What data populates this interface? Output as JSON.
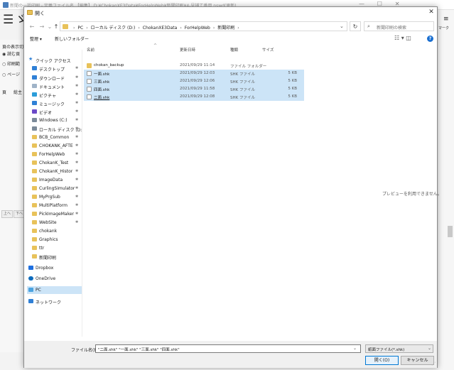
{
  "background_app": {
    "title": "新聞の一括印刷 - 定義ファイル名 【編集】 D:¥ChokanXE3Data¥ForHelpWeb¥新聞印刷¥4-見捕て番用.nswd(更新)",
    "left_labels": [
      "頁の表示切",
      "◉ 読む頁",
      "○ 印刷範",
      "○ ページ",
      "頁",
      "総主"
    ],
    "bottom_buttons": [
      "上へ",
      "下へ"
    ],
    "right_label": "マーク"
  },
  "dialog": {
    "title": "開く",
    "close_glyph": "✕",
    "nav": {
      "back": "←",
      "forward": "→",
      "recent": "⌄",
      "up": "↑",
      "breadcrumbs": [
        "PC",
        "ローカル ディスク (D:)",
        "ChokanXE3Data",
        "ForHelpWeb",
        "新聞印刷"
      ],
      "refresh": "↻",
      "search_placeholder": "新聞印刷の検索"
    },
    "toolbar": {
      "organize": "整理 ▾",
      "new_folder": "新しいフォルダー",
      "view": "☷ ▾  ◫",
      "help": "?"
    },
    "nav_pane": [
      {
        "label": "クイック アクセス",
        "icon": "star-icon",
        "pinned": false
      },
      {
        "label": "デスクトップ",
        "icon": "desktop-icon",
        "pinned": true
      },
      {
        "label": "ダウンロード",
        "icon": "download-icon",
        "pinned": true
      },
      {
        "label": "ドキュメント",
        "icon": "document-icon",
        "pinned": true
      },
      {
        "label": "ピクチャ",
        "icon": "picture-icon",
        "pinned": true
      },
      {
        "label": "ミュージック",
        "icon": "music-icon",
        "pinned": true
      },
      {
        "label": "ビデオ",
        "icon": "video-icon",
        "pinned": true
      },
      {
        "label": "Windows (C:)",
        "icon": "drive-icon",
        "pinned": true
      },
      {
        "label": "ローカル ディスク (D:",
        "icon": "drive-icon",
        "pinned": true
      },
      {
        "label": "BCB_Common",
        "icon": "folder-icon",
        "pinned": true
      },
      {
        "label": "CHOKANK_AFTE",
        "icon": "folder-icon",
        "pinned": true
      },
      {
        "label": "ForHelpWeb",
        "icon": "folder-icon",
        "pinned": true
      },
      {
        "label": "ChokanK_Test",
        "icon": "folder-icon",
        "pinned": true
      },
      {
        "label": "ChokanK_Histor",
        "icon": "folder-icon",
        "pinned": true
      },
      {
        "label": "ImageData",
        "icon": "folder-icon",
        "pinned": true
      },
      {
        "label": "CurlingSimulator",
        "icon": "folder-icon",
        "pinned": true
      },
      {
        "label": "MyPrgSub",
        "icon": "folder-icon",
        "pinned": true
      },
      {
        "label": "MultiPlatform",
        "icon": "folder-icon",
        "pinned": true
      },
      {
        "label": "PickImageMaker",
        "icon": "folder-icon",
        "pinned": true
      },
      {
        "label": "WebSite",
        "icon": "folder-icon",
        "pinned": true
      },
      {
        "label": "chokank",
        "icon": "folder-icon",
        "pinned": false
      },
      {
        "label": "Graphics",
        "icon": "folder-icon",
        "pinned": false
      },
      {
        "label": "ttr",
        "icon": "folder-icon",
        "pinned": false
      },
      {
        "label": "新聞印刷",
        "icon": "folder-icon",
        "pinned": false
      },
      {
        "label": "Dropbox",
        "icon": "dropbox-icon",
        "pinned": false
      },
      {
        "label": "OneDrive",
        "icon": "onedrive-icon",
        "pinned": false
      },
      {
        "label": "PC",
        "icon": "pc-icon",
        "pinned": false,
        "selected": true
      },
      {
        "label": "ネットワーク",
        "icon": "network-icon",
        "pinned": false
      }
    ],
    "pin_glyph": "📌",
    "columns": {
      "name": "名前",
      "date": "更新日時",
      "type": "種類",
      "size": "サイズ",
      "sort_glyph": "^"
    },
    "files": [
      {
        "name": "chokan_backup",
        "date": "2021/09/29 11:14",
        "type": "ファイル フォルダー",
        "size": "",
        "kind": "folder",
        "selected": false
      },
      {
        "name": "一面.shk",
        "date": "2021/09/29 12:03",
        "type": "SHK ファイル",
        "size": "5 KB",
        "kind": "file",
        "selected": true
      },
      {
        "name": "三面.shk",
        "date": "2021/09/29 12:06",
        "type": "SHK ファイル",
        "size": "5 KB",
        "kind": "file",
        "selected": true
      },
      {
        "name": "四面.shk",
        "date": "2021/09/29 11:58",
        "type": "SHK ファイル",
        "size": "5 KB",
        "kind": "file",
        "selected": true
      },
      {
        "name": "二面.shk",
        "date": "2021/09/29 12:08",
        "type": "SHK ファイル",
        "size": "5 KB",
        "kind": "file",
        "selected": true,
        "focused": true
      }
    ],
    "preview_message": "プレビューを利用できません。",
    "bottom": {
      "filename_label": "ファイル名(N):",
      "filename_value": "\"二面.shk\" \"一面.shk\" \"三面.shk\" \"四面.shk\"",
      "filter_value": "紙面ファイル(*.shk)",
      "open_label": "開く(O)",
      "cancel_label": "キャンセル"
    }
  },
  "colors": {
    "selection": "#cce4f7",
    "accent": "#0078d4",
    "folder": "#e8c25a"
  }
}
